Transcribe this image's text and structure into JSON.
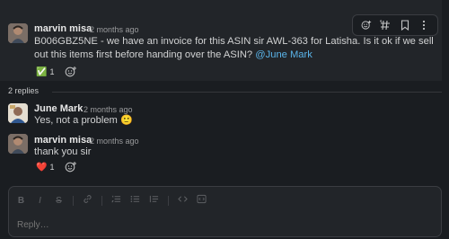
{
  "thread": {
    "parent": {
      "author": "marvin misa",
      "time": "2 months ago",
      "text": "B006GBZ5NE - we have an invoice for this ASIN sir AWL-363 for Latisha. Is it ok if we sell out this items first before handing over the ASIN?",
      "mention": "@June Mark",
      "reaction": {
        "emoji": "✅",
        "count": "1"
      }
    },
    "replies_label": "2 replies",
    "replies": [
      {
        "author": "June Mark",
        "time": "2 months ago",
        "text": "Yes, not a problem",
        "emoji": "🙂"
      },
      {
        "author": "marvin misa",
        "time": "2 months ago",
        "text": "thank you sir",
        "reaction": {
          "emoji": "❤️",
          "count": "1"
        }
      }
    ]
  },
  "toolbar": {
    "icons": [
      "add-reaction-icon",
      "hash-icon",
      "bookmark-icon",
      "more-icon"
    ],
    "labels": [
      "☺",
      "#",
      "▯",
      "⋮"
    ]
  },
  "composer": {
    "placeholder": "Reply…",
    "format_buttons": [
      "B",
      "I",
      "S"
    ],
    "format_icons": [
      "link-icon",
      "ordered-list-icon",
      "bullet-list-icon",
      "quote-icon",
      "code-icon",
      "code-block-icon"
    ]
  }
}
